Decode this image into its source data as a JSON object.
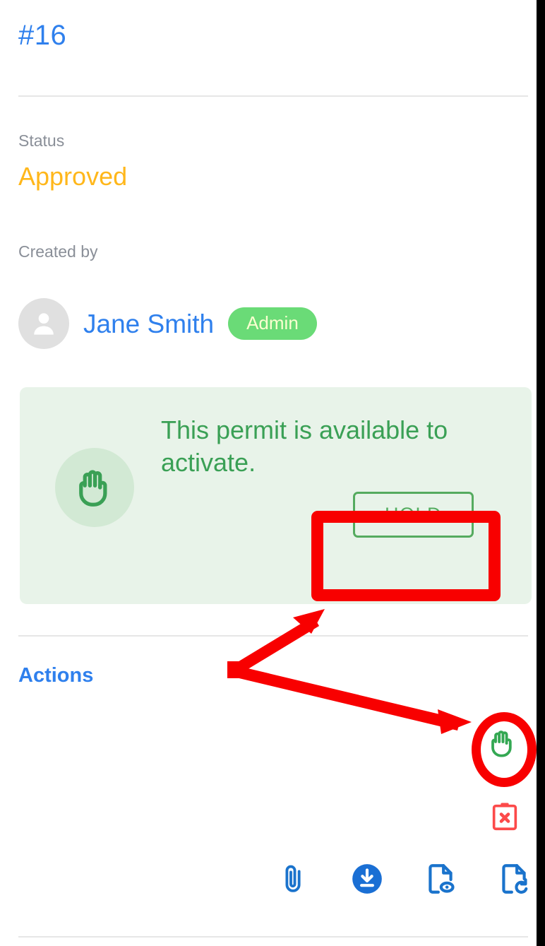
{
  "record": {
    "id_label": "#16"
  },
  "fields": {
    "status_label": "Status",
    "status_value": "Approved",
    "created_by_label": "Created by",
    "creator_name": "Jane Smith",
    "creator_role_badge": "Admin"
  },
  "alert": {
    "message": "This permit is available to activate.",
    "hold_button_label": "HOLD",
    "icon": "hand-stop-icon"
  },
  "actions": {
    "heading": "Actions",
    "items": [
      {
        "name": "hold-permit-icon",
        "icon": "hand-stop-icon"
      },
      {
        "name": "cancel-permit-icon",
        "icon": "clipboard-x-icon"
      },
      {
        "name": "attach-file-icon",
        "icon": "paperclip-icon"
      },
      {
        "name": "download-icon",
        "icon": "download-circle-icon"
      },
      {
        "name": "preview-document-icon",
        "icon": "document-eye-icon"
      },
      {
        "name": "renew-document-icon",
        "icon": "document-refresh-icon"
      }
    ]
  },
  "colors": {
    "link_blue": "#2f80ed",
    "status_amber": "#ffb71b",
    "badge_green": "#6adb77",
    "alert_green_bg": "#e8f3e9",
    "alert_green_text": "#3aa055",
    "hold_border_green": "#55ab5f",
    "annotation_red": "#f80000",
    "icon_blue": "#1a73cc",
    "cancel_red": "#fc4a4a",
    "muted_gray": "#8a8f98",
    "divider_gray": "#e6e6e6"
  }
}
